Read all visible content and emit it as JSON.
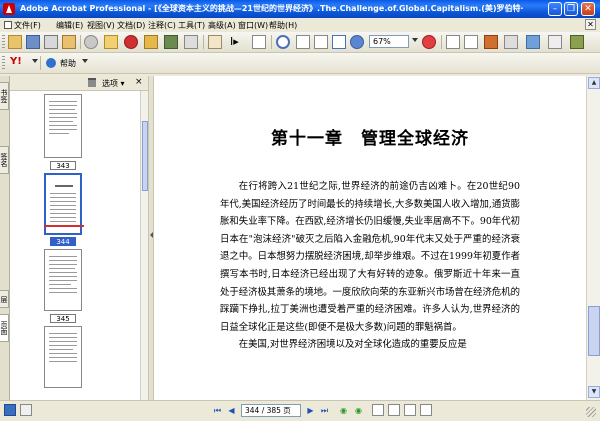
{
  "window": {
    "title": "Adobe Acrobat Professional - [《全球资本主义的挑战—21世纪的世界经济》.The.Challenge.of.Global.Capitalism.(美)罗伯特·"
  },
  "menu": {
    "items": [
      "文件(F)",
      "编辑(E)",
      "视图(V)",
      "文档(D)",
      "注释(C)",
      "工具(T)",
      "高级(A)",
      "窗口(W)",
      "帮助(H)"
    ]
  },
  "toolbar": {
    "zoom_value": "67%",
    "help_label": "帮助"
  },
  "sidebar": {
    "options_label": "选项",
    "tabs": [
      "书签",
      "签名",
      "层",
      "页面"
    ],
    "thumbnails": [
      {
        "label": "343",
        "selected": false
      },
      {
        "label": "344",
        "selected": true
      },
      {
        "label": "345",
        "selected": false
      },
      {
        "label": "",
        "selected": false
      }
    ]
  },
  "document": {
    "chapter_title": "第十一章　管理全球经济",
    "paragraphs": [
      "在行将跨入21世纪之际,世界经济的前途仍吉凶难卜。在20世纪90年代,美国经济经历了时间最长的持续增长,大多数美国人收入增加,通货膨胀和失业率下降。在西欧,经济增长仍旧缓慢,失业率居高不下。90年代初日本在\"泡沫经济\"破灭之后陷入金融危机,90年代末又处于严重的经济衰退之中。日本想努力摆脱经济困境,却举步维艰。不过在1999年初夏作者撰写本书时,日本经济已经出现了大有好转的迹象。俄罗斯近十年来一直处于经济极其萧条的境地。一度欣欣向荣的东亚新兴市场曾在经济危机的踩躏下挣扎,拉丁美洲也遭受着严重的经济困难。许多人认为,世界经济的日益全球化正是这些(即便不是极大多数)问题的罪魁祸首。",
      "在美国,对世界经济困境以及对全球化造成的重要反应是"
    ]
  },
  "statusbar": {
    "page_indicator": "344 / 385 页"
  }
}
